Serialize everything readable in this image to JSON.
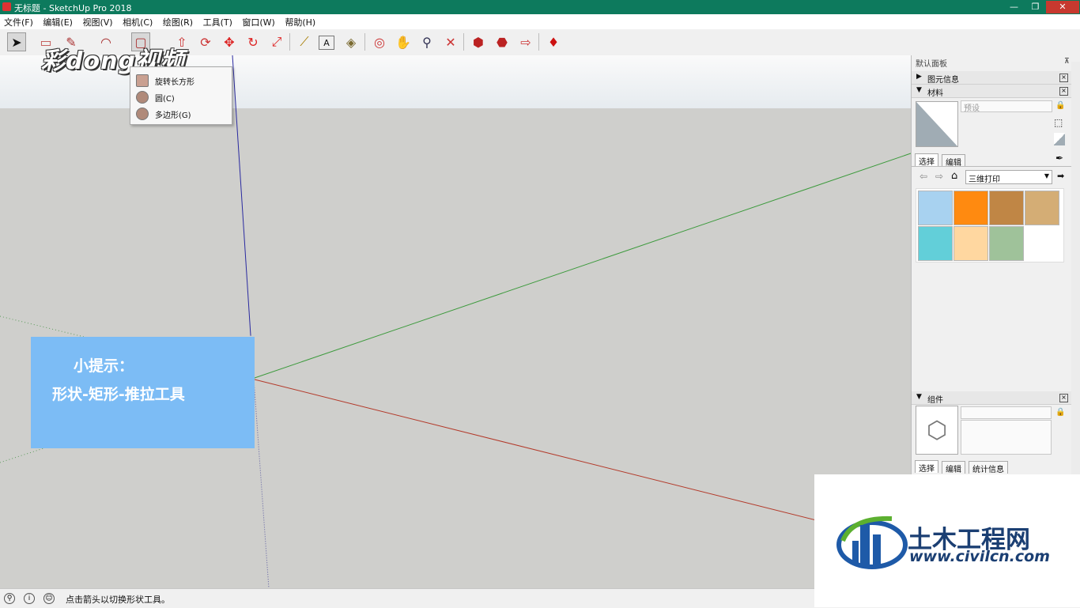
{
  "window": {
    "title": "无标题 - SketchUp Pro 2018",
    "controls": [
      "—",
      "❐",
      "✕"
    ]
  },
  "menu": [
    "文件(F)",
    "编辑(E)",
    "视图(V)",
    "相机(C)",
    "绘图(R)",
    "工具(T)",
    "窗口(W)",
    "帮助(H)"
  ],
  "toolbar": [
    {
      "name": "select-tool-icon",
      "glyph": "➤"
    },
    {
      "name": "eraser-tool-icon",
      "glyph": "▭"
    },
    {
      "name": "line-tool-icon",
      "glyph": "✎"
    },
    {
      "name": "arc-tool-icon",
      "glyph": "◠"
    },
    {
      "name": "shape-tool-icon",
      "glyph": "▢"
    },
    {
      "name": "pushpull-tool-icon",
      "glyph": "⇧"
    },
    {
      "name": "offset-tool-icon",
      "glyph": "⟳"
    },
    {
      "name": "move-tool-icon",
      "glyph": "✥"
    },
    {
      "name": "rotate-tool-icon",
      "glyph": "↻"
    },
    {
      "name": "scale-tool-icon",
      "glyph": "⤢"
    },
    {
      "name": "tape-measure-icon",
      "glyph": "⟋"
    },
    {
      "name": "text-tool-icon",
      "glyph": "A"
    },
    {
      "name": "paint-bucket-icon",
      "glyph": "◈"
    },
    {
      "name": "orbit-tool-icon",
      "glyph": "◎"
    },
    {
      "name": "pan-tool-icon",
      "glyph": "✋"
    },
    {
      "name": "zoom-tool-icon",
      "glyph": "⚲"
    },
    {
      "name": "zoom-extents-icon",
      "glyph": "✕"
    },
    {
      "name": "warehouse-icon",
      "glyph": "⬢"
    },
    {
      "name": "extension-warehouse-icon",
      "glyph": "⬣"
    },
    {
      "name": "share-model-icon",
      "glyph": "⇨"
    },
    {
      "name": "ruby-icon",
      "glyph": "♦"
    }
  ],
  "watermark_logo": "彩dong视频",
  "shape_menu": [
    "旋转长方形",
    "圆(C)",
    "多边形(G)"
  ],
  "tip": {
    "line1": "小提示：",
    "line2": "形状-矩形-推拉工具"
  },
  "panel": {
    "title": "默认面板",
    "entity_info": "图元信息",
    "materials": "材料",
    "material_name_placeholder": "预设",
    "tabs": [
      "选择",
      "编辑"
    ],
    "library": "三维打印",
    "swatch_colors": [
      "#a8d2f0",
      "#ff8a10",
      "#c08645",
      "#d4ad75",
      "#62cfd9",
      "#ffd7a0",
      "#9fc29a"
    ],
    "components": "组件",
    "component_tabs": [
      "选择",
      "编辑",
      "统计信息"
    ]
  },
  "status": {
    "message": "点击箭头以切换形状工具。"
  },
  "civil": {
    "name": "土木工程网",
    "url": "www.civilcn.com"
  }
}
